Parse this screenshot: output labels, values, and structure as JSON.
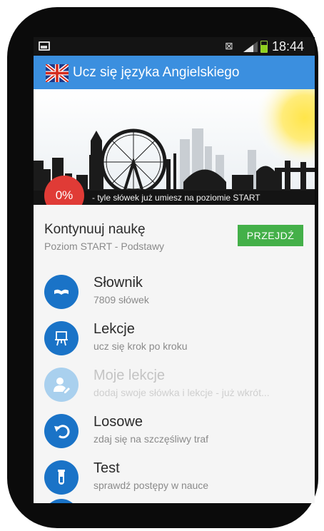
{
  "status_bar": {
    "time": "18:44",
    "icons": [
      "image-icon",
      "no-sim-icon",
      "signal-icon",
      "battery-icon"
    ]
  },
  "app_bar": {
    "title": "Ucz się języka Angielskiego",
    "icon": "uk-flag-icon"
  },
  "banner": {
    "progress_percent": "0%",
    "progress_text": "- tyle słówek już umiesz na poziomie START"
  },
  "continue": {
    "title": "Kontynuuj naukę",
    "subtitle": "Poziom START - Podstawy",
    "button_label": "PRZEJDŹ"
  },
  "menu": [
    {
      "title": "Słownik",
      "subtitle": "7809 słówek",
      "icon": "book-icon",
      "enabled": true
    },
    {
      "title": "Lekcje",
      "subtitle": "ucz się krok po kroku",
      "icon": "easel-icon",
      "enabled": true
    },
    {
      "title": "Moje lekcje",
      "subtitle": "dodaj swoje słówka i lekcje - już wkrót...",
      "icon": "user-edit-icon",
      "enabled": false
    },
    {
      "title": "Losowe",
      "subtitle": "zdaj się na szczęśliwy traf",
      "icon": "undo-icon",
      "enabled": true
    },
    {
      "title": "Test",
      "subtitle": "sprawdź postępy w nauce",
      "icon": "test-tube-icon",
      "enabled": true
    }
  ],
  "colors": {
    "app_bar": "#3b8fdf",
    "accent_icon": "#1a73c7",
    "button_green": "#44b049",
    "badge_red": "#e03b36"
  }
}
